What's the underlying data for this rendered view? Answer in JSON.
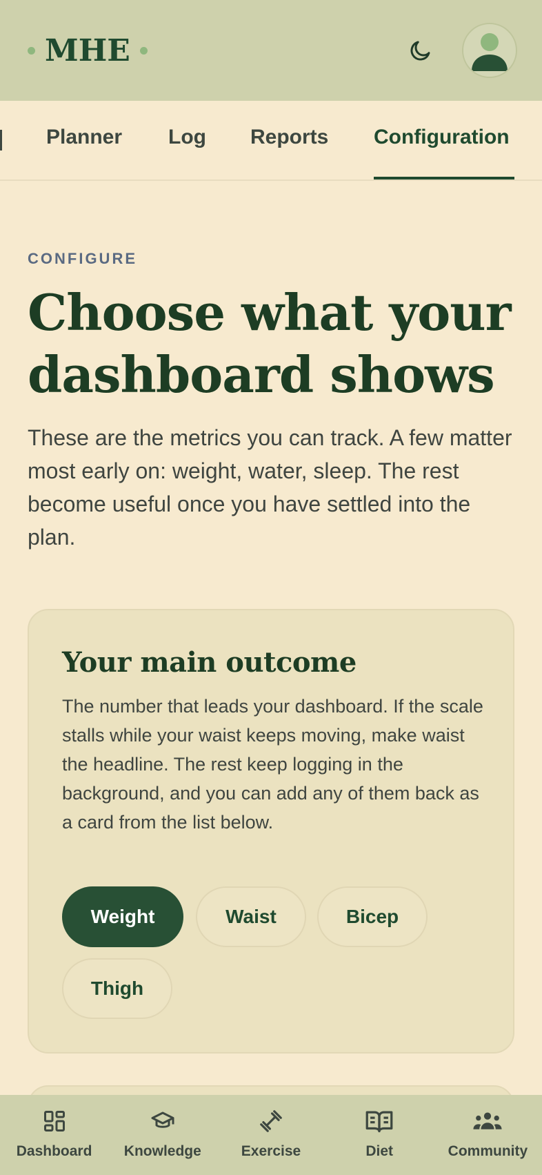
{
  "header": {
    "logo_text": "MHE",
    "theme_icon": "moon-icon",
    "avatar_icon": "user-avatar-icon"
  },
  "tabs": [
    {
      "label": "Planner",
      "active": false
    },
    {
      "label": "Log",
      "active": false
    },
    {
      "label": "Reports",
      "active": false
    },
    {
      "label": "Configuration",
      "active": true
    }
  ],
  "main": {
    "eyebrow": "CONFIGURE",
    "title": "Choose what your dashboard shows",
    "intro": "These are the metrics you can track. A few matter most early on: weight, water, sleep. The rest become useful once you have settled into the plan."
  },
  "outcome_card": {
    "title": "Your main outcome",
    "description": "The number that leads your dashboard. If the scale stalls while your waist keeps moving, make waist the headline. The rest keep logging in the background, and you can add any of them back as a card from the list below.",
    "options": [
      {
        "label": "Weight",
        "selected": true
      },
      {
        "label": "Waist",
        "selected": false
      },
      {
        "label": "Bicep",
        "selected": false
      },
      {
        "label": "Thigh",
        "selected": false
      }
    ]
  },
  "bottom_nav": [
    {
      "label": "Dashboard",
      "icon": "dashboard-icon"
    },
    {
      "label": "Knowledge",
      "icon": "graduation-cap-icon"
    },
    {
      "label": "Exercise",
      "icon": "dumbbell-icon"
    },
    {
      "label": "Diet",
      "icon": "book-icon"
    },
    {
      "label": "Community",
      "icon": "group-icon"
    }
  ],
  "colors": {
    "background": "#f7eacf",
    "header": "#ced1ac",
    "brand_green": "#1f4a2f",
    "selected_chip": "#285035",
    "card": "#ebe2c0",
    "eyebrow": "#5a6a82"
  }
}
